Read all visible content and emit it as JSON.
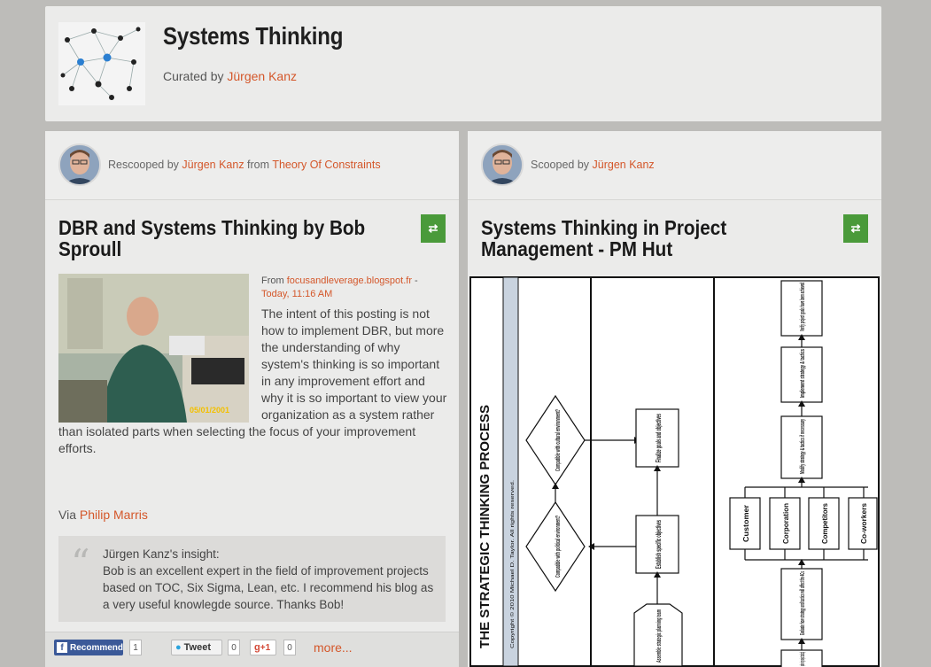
{
  "header": {
    "title": "Systems Thinking",
    "curated_prefix": "Curated by ",
    "curator": "Jürgen Kanz"
  },
  "left_card": {
    "byline_prefix": "Rescooped by ",
    "byline_user": "Jürgen Kanz",
    "byline_mid": " from ",
    "byline_source": "Theory Of Constraints",
    "title": "DBR and Systems Thinking by Bob Sproull",
    "from_prefix": "From ",
    "from_domain": "focusandleverage.blogspot.fr",
    "from_sep": " -",
    "from_date": "Today, 11:16 AM",
    "photo_stamp": "05/01/2001",
    "excerpt": "The intent of this posting is not how to implement DBR, but more the understanding of why system's thinking is so important in any improvement effort and why it is so important to view your organization as a system rather than isolated parts when selecting the focus of your improvement efforts.",
    "via_prefix": "Via ",
    "via_user": "Philip Marris",
    "insight_label": "Jürgen Kanz's insight:",
    "insight_text": "Bob is an excellent expert in the field of improvement projects based on TOC, Six Sigma, Lean, etc. I recommend his blog as a very useful knowlegde source. Thanks Bob!",
    "share": {
      "recommend_label": "Recommend",
      "recommend_count": "1",
      "tweet_label": "Tweet",
      "tweet_count": "0",
      "gplus_label": "+1",
      "gplus_count": "0",
      "more_label": "more..."
    }
  },
  "right_card": {
    "byline_prefix": "Scooped by ",
    "byline_user": "Jürgen Kanz",
    "title": "Systems Thinking in Project Management - PM Hut",
    "diagram": {
      "heading": "THE STRATEGIC THINKING PROCESS",
      "copyright": "Copyright © 2010 Michael D. Taylor. All rights reserved.",
      "d1": "Compatible with cultural environment?",
      "d2": "Compatible with political environment?",
      "b_goals": "Finalize goals and objectives",
      "b_objectives": "Establish specific objectives",
      "h_assemble": "Assemble strategic planning team",
      "b_verify": "Verify project goals have been achieved",
      "b_implement": "Implement strategy & tactics",
      "b_modify": "Modify strategy & tactics if necessary",
      "c1": "Customer",
      "c2": "Corporation",
      "c3": "Competitors",
      "c4": "Co-workers",
      "b_evaluate": "Evaluate how strategy and tactics will affect the 4Cs",
      "b_plan": "plan ving roject tactics)"
    }
  }
}
